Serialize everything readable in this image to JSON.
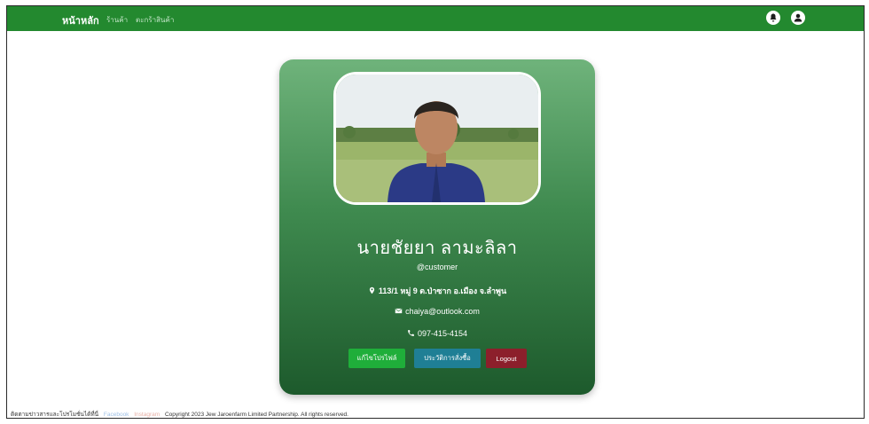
{
  "navbar": {
    "brand": "หน้าหลัก",
    "links": [
      "ร้านค้า",
      "ตะกร้าสินค้า"
    ],
    "icons": [
      "bell-icon",
      "user-icon"
    ]
  },
  "profile": {
    "name": "นายชัยยา ลามะลิลา",
    "username": "@customer",
    "address": "113/1 หมู่ 9 ต.ป่าซาก อ.เมือง จ.ลำพูน",
    "email": "chaiya@outlook.com",
    "phone": "097-415-4154"
  },
  "buttons": {
    "edit": "แก้ไขโปรไฟล์",
    "history": "ประวัติการสั่งซื้อ",
    "logout": "Logout"
  },
  "footer": {
    "contact_text": "ติดตามข่าวสารและโปรโมชั่นได้ที่นี่",
    "facebook": "Facebook",
    "instagram": "Instagram",
    "copyright": "Copyright 2023 Jew Jaroenfarm Limited Partnership. All rights reserved."
  },
  "colors": {
    "navbar": "#23892f",
    "edit_button": "#1fae3a",
    "history_button": "#1f7f95",
    "logout_button": "#8c1f2b"
  }
}
